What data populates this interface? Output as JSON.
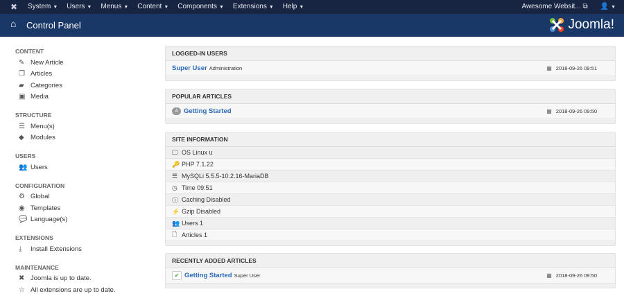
{
  "nav": {
    "menus": [
      "System",
      "Users",
      "Menus",
      "Content",
      "Components",
      "Extensions",
      "Help"
    ],
    "site_link": "Awesome Websit...",
    "user_icon": "user-icon"
  },
  "header": {
    "title": "Control Panel",
    "brand": "Joomla!"
  },
  "sidebar": {
    "sections": [
      {
        "title": "CONTENT",
        "items": [
          {
            "label": "New Article",
            "icon": "✎"
          },
          {
            "label": "Articles",
            "icon": "❐"
          },
          {
            "label": "Categories",
            "icon": "▰"
          },
          {
            "label": "Media",
            "icon": "▣"
          }
        ]
      },
      {
        "title": "STRUCTURE",
        "items": [
          {
            "label": "Menu(s)",
            "icon": "☰"
          },
          {
            "label": "Modules",
            "icon": "◆"
          }
        ]
      },
      {
        "title": "USERS",
        "items": [
          {
            "label": "Users",
            "icon": "👥"
          }
        ]
      },
      {
        "title": "CONFIGURATION",
        "items": [
          {
            "label": "Global",
            "icon": "⚙"
          },
          {
            "label": "Templates",
            "icon": "◉"
          },
          {
            "label": "Language(s)",
            "icon": "💬"
          }
        ]
      },
      {
        "title": "EXTENSIONS",
        "items": [
          {
            "label": "Install Extensions",
            "icon": "⤓"
          }
        ]
      },
      {
        "title": "MAINTENANCE",
        "items": [
          {
            "label": "Joomla is up to date.",
            "icon": "✖"
          },
          {
            "label": "All extensions are up to date.",
            "icon": "☆"
          }
        ]
      }
    ]
  },
  "logged_in": {
    "title": "LOGGED-IN USERS",
    "user": "Super User",
    "client": "Administration",
    "date": "2018-09-26 09:51"
  },
  "popular": {
    "title": "POPULAR ARTICLES",
    "hits": "4",
    "article": "Getting Started",
    "date": "2018-09-26 09:50"
  },
  "site_info": {
    "title": "SITE INFORMATION",
    "rows": [
      {
        "icon": "🖵",
        "text": "OS Linux u"
      },
      {
        "icon": "🔑",
        "text": "PHP 7.1.22"
      },
      {
        "icon": "☰",
        "text": "MySQLi 5.5.5-10.2.16-MariaDB"
      },
      {
        "icon": "◷",
        "text": "Time 09:51"
      },
      {
        "icon": "ⓘ",
        "text": "Caching Disabled"
      },
      {
        "icon": "⚡",
        "text": "Gzip Disabled"
      },
      {
        "icon": "👥",
        "text": "Users 1"
      },
      {
        "icon": "🗋",
        "text": "Articles 1"
      }
    ]
  },
  "recent": {
    "title": "RECENTLY ADDED ARTICLES",
    "article": "Getting Started",
    "author": "Super User",
    "date": "2018-09-26 09:50"
  }
}
